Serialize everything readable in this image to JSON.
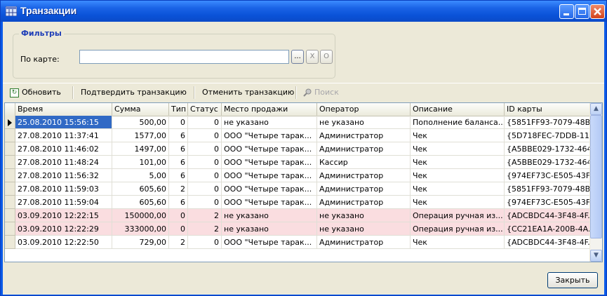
{
  "window": {
    "title": "Транзакции",
    "icon": "table-app-icon"
  },
  "filters": {
    "group_title": "Фильтры",
    "card_label": "По карте:",
    "card_value": "",
    "browse_label": "...",
    "clear_label": "X",
    "reset_label": "O"
  },
  "toolbar": {
    "refresh": "Обновить",
    "confirm": "Подтвердить транзакцию",
    "cancel": "Отменить транзакцию",
    "search": "Поиск"
  },
  "table": {
    "columns": [
      "Время",
      "Сумма",
      "Тип",
      "Статус",
      "Место продажи",
      "Оператор",
      "Описание",
      "ID карты"
    ],
    "rows": [
      {
        "time": "25.08.2010 15:56:15",
        "sum": "500,00",
        "type": "0",
        "status": "0",
        "place": "не указано",
        "operator": "не указано",
        "desc": "Пополнение баланса...",
        "card": "{5851FF93-7079-48B...",
        "highlight": false,
        "selected": true
      },
      {
        "time": "27.08.2010 11:37:41",
        "sum": "1577,00",
        "type": "6",
        "status": "0",
        "place": "ООО \"Четыре тарак...",
        "operator": "Администратор",
        "desc": "Чек",
        "card": "{5D718FEC-7DDB-11...",
        "highlight": false,
        "selected": false
      },
      {
        "time": "27.08.2010 11:46:02",
        "sum": "1497,00",
        "type": "6",
        "status": "0",
        "place": "ООО \"Четыре тарак...",
        "operator": "Администратор",
        "desc": "Чек",
        "card": "{A5BBE029-1732-464...",
        "highlight": false,
        "selected": false
      },
      {
        "time": "27.08.2010 11:48:24",
        "sum": "101,00",
        "type": "6",
        "status": "0",
        "place": "ООО \"Четыре тарак...",
        "operator": "Кассир",
        "desc": "Чек",
        "card": "{A5BBE029-1732-464...",
        "highlight": false,
        "selected": false
      },
      {
        "time": "27.08.2010 11:56:32",
        "sum": "5,00",
        "type": "6",
        "status": "0",
        "place": "ООО \"Четыре тарак...",
        "operator": "Администратор",
        "desc": "Чек",
        "card": "{974EF73C-E505-43F...",
        "highlight": false,
        "selected": false
      },
      {
        "time": "27.08.2010 11:59:03",
        "sum": "605,60",
        "type": "2",
        "status": "0",
        "place": "ООО \"Четыре тарак...",
        "operator": "Администратор",
        "desc": "Чек",
        "card": "{5851FF93-7079-48B...",
        "highlight": false,
        "selected": false
      },
      {
        "time": "27.08.2010 11:59:04",
        "sum": "605,60",
        "type": "6",
        "status": "0",
        "place": "ООО \"Четыре тарак...",
        "operator": "Администратор",
        "desc": "Чек",
        "card": "{974EF73C-E505-43F...",
        "highlight": false,
        "selected": false
      },
      {
        "time": "03.09.2010 12:22:15",
        "sum": "150000,00",
        "type": "0",
        "status": "2",
        "place": "не указано",
        "operator": "не указано",
        "desc": "Операция ручная из...",
        "card": "{ADCBDC44-3F48-4F...",
        "highlight": true,
        "selected": false
      },
      {
        "time": "03.09.2010 12:22:29",
        "sum": "333000,00",
        "type": "0",
        "status": "2",
        "place": "не указано",
        "operator": "не указано",
        "desc": "Операция ручная из...",
        "card": "{CC21EA1A-200B-4A...",
        "highlight": true,
        "selected": false
      },
      {
        "time": "03.09.2010 12:22:50",
        "sum": "729,00",
        "type": "2",
        "status": "0",
        "place": "ООО \"Четыре тарак...",
        "operator": "Администратор",
        "desc": "Чек",
        "card": "{ADCBDC44-3F48-4F...",
        "highlight": false,
        "selected": false
      }
    ]
  },
  "footer": {
    "close": "Закрыть"
  },
  "colors": {
    "selection": "#316ac5",
    "highlight_row": "#fadde0",
    "titlebar": "#0a52d8"
  }
}
